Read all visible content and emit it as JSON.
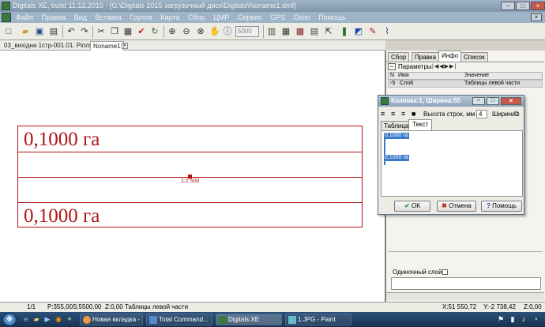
{
  "window": {
    "title": "Digitals XE, build 11.12.2015 - [G:\\Digitals 2015 загрузочный диск\\Digitals\\Noname1.dmf]"
  },
  "menu": [
    "Файл",
    "Правка",
    "Вид",
    "Вставка",
    "Группа",
    "Карта",
    "Сбор",
    "ЦМР",
    "Сервис",
    "GPS",
    "Окно",
    "Помощь"
  ],
  "toolbar": {
    "zoom_value": "5000"
  },
  "doc_tabs": [
    "03_вихідна 1стр-001.01. Ріпля",
    "Noname1"
  ],
  "canvas": {
    "label_top": "0,1000 га",
    "label_bottom": "0,1000 га",
    "scale_label": "1:2 500",
    "colors": {
      "line": "#b01515"
    }
  },
  "right_panel": {
    "tabs": [
      "Сбор",
      "Правка",
      "Инфо",
      "Список"
    ],
    "active_tab": "Инфо",
    "params_label": "Параметры",
    "table_headers": [
      "N",
      "Имя",
      "Значение"
    ],
    "rows": [
      {
        "n": "-5",
        "name": "Слой",
        "value": "Таблицы левой части"
      }
    ],
    "single_layer_label": "Одиночный слой"
  },
  "dialog": {
    "title": "Колонка:1, Ширина:55",
    "row_height_label": "Высота строк, мм",
    "row_height_value": "4",
    "width_label": "Ширина",
    "tabs": [
      "Таблица",
      "Текст"
    ],
    "active_tab": "Текст",
    "text_lines": [
      "0,1000 га",
      "0,1000 га"
    ],
    "buttons": {
      "ok": "ОК",
      "cancel": "Отмена",
      "help": "Помощь"
    }
  },
  "status": {
    "page": "1/1",
    "p": "P:355,00",
    "s": "S:5500,00",
    "z": "Z:0,00",
    "layer": "Таблицы левой части",
    "x": "X:51 550,72",
    "y": "Y:-2 738,42",
    "z2": "Z:0,00"
  },
  "taskbar": {
    "items": [
      "Новая вкладка - ...",
      "Total Command...",
      "Digitals XE",
      "1.JPG - Paint"
    ]
  }
}
